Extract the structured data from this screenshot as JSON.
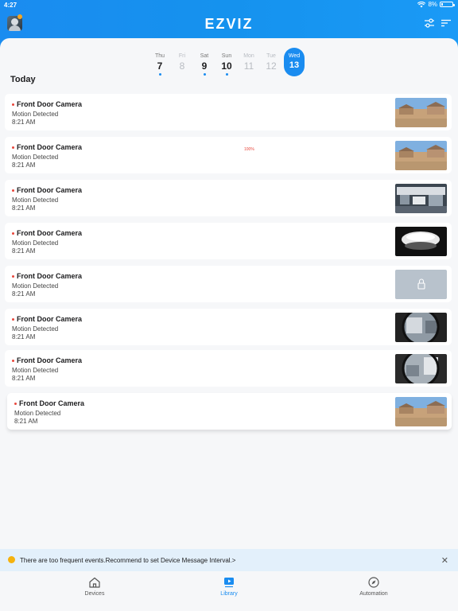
{
  "status_bar": {
    "time": "4:27",
    "battery": "8%"
  },
  "header": {
    "logo": "EZVIZ",
    "icons": [
      "avatar",
      "filter-icon",
      "sort-icon"
    ]
  },
  "date_strip": [
    {
      "name": "Thu",
      "num": "7",
      "has_events": true,
      "muted": false,
      "selected": false
    },
    {
      "name": "Fri",
      "num": "8",
      "has_events": false,
      "muted": true,
      "selected": false
    },
    {
      "name": "Sat",
      "num": "9",
      "has_events": true,
      "muted": false,
      "selected": false
    },
    {
      "name": "Sun",
      "num": "10",
      "has_events": true,
      "muted": false,
      "selected": false
    },
    {
      "name": "Mon",
      "num": "11",
      "has_events": false,
      "muted": true,
      "selected": false
    },
    {
      "name": "Tue",
      "num": "12",
      "has_events": false,
      "muted": true,
      "selected": false
    },
    {
      "name": "Wed",
      "num": "13",
      "has_events": false,
      "muted": false,
      "selected": true
    }
  ],
  "section_title": "Today",
  "events": [
    {
      "title": "Front Door Camera",
      "subtitle": "Motion Detected",
      "time": "8:21 AM",
      "thumb": "outdoor-houses"
    },
    {
      "title": "Front Door Camera",
      "subtitle": "Motion Detected",
      "time": "8:21 AM",
      "thumb": "outdoor-houses"
    },
    {
      "title": "Front Door Camera",
      "subtitle": "Motion Detected",
      "time": "8:21 AM",
      "thumb": "office-interior"
    },
    {
      "title": "Front Door Camera",
      "subtitle": "Motion Detected",
      "time": "8:21 AM",
      "thumb": "fisheye-dark"
    },
    {
      "title": "Front Door Camera",
      "subtitle": "Motion Detected",
      "time": "8:21 AM",
      "thumb": "locked"
    },
    {
      "title": "Front Door Camera",
      "subtitle": "Motion Detected",
      "time": "8:21 AM",
      "thumb": "fisheye-room"
    },
    {
      "title": "Front Door Camera",
      "subtitle": "Motion Detected",
      "time": "8:21 AM",
      "thumb": "fisheye-room2"
    },
    {
      "title": "Front Door Camera",
      "subtitle": "Motion Detected",
      "time": "8:21 AM",
      "thumb": "outdoor-houses"
    }
  ],
  "progress_label": "100%",
  "notice": {
    "text": "There are too frequent events.Recommend to set Device Message Interval.>",
    "close": "✕"
  },
  "tabs": [
    {
      "label": "Devices",
      "icon": "home-icon",
      "active": false
    },
    {
      "label": "Library",
      "icon": "library-icon",
      "active": true
    },
    {
      "label": "Automation",
      "icon": "compass-icon",
      "active": false
    }
  ],
  "colors": {
    "accent": "#1a8cf0",
    "event_dot": "#e8473c",
    "notice_bg": "#e3f0fb",
    "notice_icon": "#f5b20e"
  }
}
